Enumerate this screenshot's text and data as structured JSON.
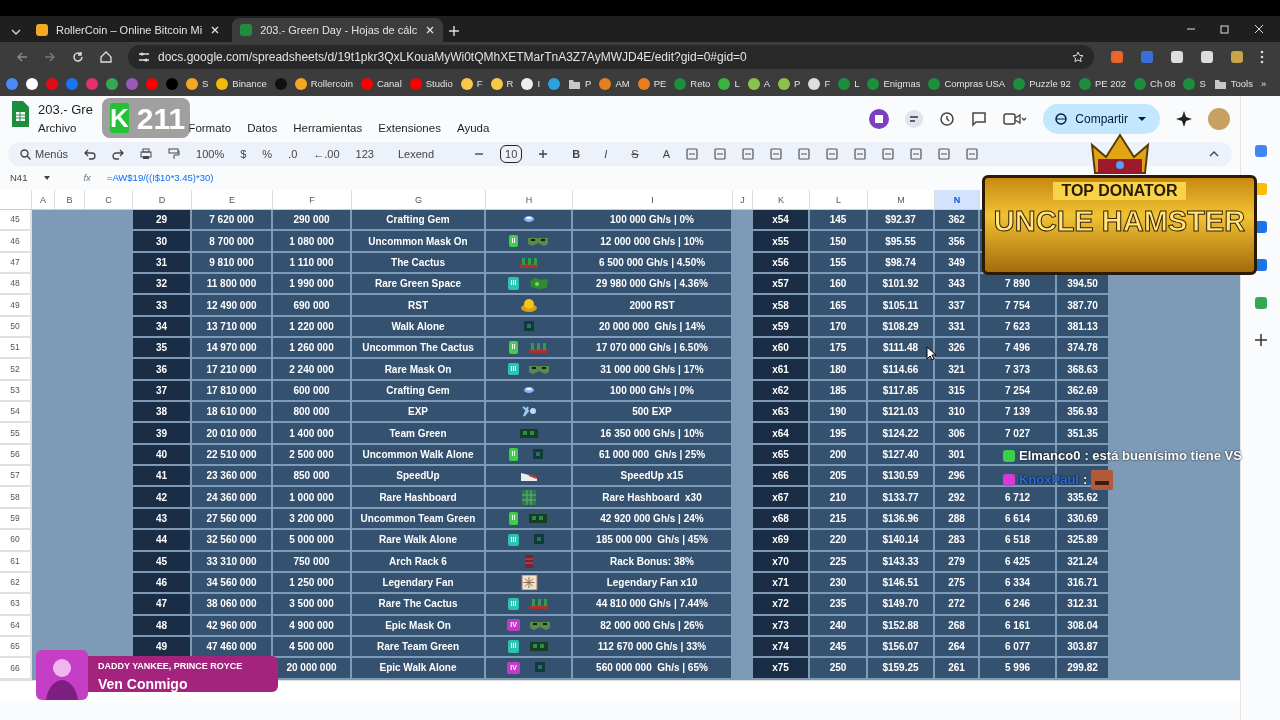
{
  "browser": {
    "tabs": [
      {
        "title": "RollerCoin – Online Bitcoin Mi",
        "color": "#f5a623",
        "selected": false
      },
      {
        "title": "203.- Green Day - Hojas de cálc",
        "color": "#1e8e3e",
        "selected": true
      }
    ],
    "url": "docs.google.com/spreadsheets/d/19t1pkr3QxLKouaMyWi0tQMhXETMarTnA3Z7AyMWJD4E/edit?gid=0#gid=0",
    "bookmarks": [
      {
        "kind": "site",
        "color": "#4a8af4"
      },
      {
        "kind": "site",
        "color": "#ffffff"
      },
      {
        "kind": "site",
        "color": "#e50914"
      },
      {
        "kind": "site",
        "color": "#1877f2"
      },
      {
        "kind": "site",
        "color": "#e1306c"
      },
      {
        "kind": "site",
        "color": "#34a853"
      },
      {
        "kind": "site",
        "color": "#9b59b6"
      },
      {
        "kind": "site",
        "color": "#ff0000"
      },
      {
        "kind": "site",
        "color": "#000000"
      },
      {
        "kind": "site",
        "label": "S",
        "color": "#f5a623"
      },
      {
        "kind": "site",
        "label": "Binance",
        "color": "#f0b90b"
      },
      {
        "kind": "site",
        "color": "#111111"
      },
      {
        "kind": "site",
        "label": "Rollercoin",
        "color": "#f5a623"
      },
      {
        "kind": "site",
        "label": "Canal",
        "color": "#ff0000"
      },
      {
        "kind": "site",
        "label": "Studio",
        "color": "#ff0000"
      },
      {
        "kind": "site",
        "label": "F",
        "color": "#f7c948"
      },
      {
        "kind": "site",
        "label": "R",
        "color": "#f7c948"
      },
      {
        "kind": "site",
        "label": "I",
        "color": "#eeeeee"
      },
      {
        "kind": "site",
        "color": "#2aa3e0"
      },
      {
        "kind": "folder",
        "label": "P",
        "color": "#c4c7c5"
      },
      {
        "kind": "site",
        "label": "AM",
        "color": "#e67e22"
      },
      {
        "kind": "site",
        "label": "PE",
        "color": "#e67e22"
      },
      {
        "kind": "site",
        "label": "Reto",
        "color": "#1e8e3e"
      },
      {
        "kind": "site",
        "label": "L",
        "color": "#3cb043"
      },
      {
        "kind": "site",
        "label": "A",
        "color": "#8bc34a"
      },
      {
        "kind": "site",
        "label": "P",
        "color": "#8bc34a"
      },
      {
        "kind": "site",
        "label": "F",
        "color": "#dddddd"
      },
      {
        "kind": "site",
        "label": "L",
        "color": "#1e8e3e"
      },
      {
        "kind": "site",
        "label": "Enigmas",
        "color": "#1e8e3e"
      },
      {
        "kind": "site",
        "label": "Compras USA",
        "color": "#1e8e3e"
      },
      {
        "kind": "site",
        "label": "Puzzle 92",
        "color": "#1e8e3e"
      },
      {
        "kind": "site",
        "label": "PE 202",
        "color": "#1e8e3e"
      },
      {
        "kind": "site",
        "label": "Ch 08",
        "color": "#1e8e3e"
      },
      {
        "kind": "site",
        "label": "S",
        "color": "#1e8e3e"
      },
      {
        "kind": "folder",
        "label": "Tools",
        "color": "#c4c7c5"
      }
    ],
    "bookmarks_more": "»"
  },
  "sheet": {
    "title": "203.- Gre",
    "menus": [
      "Archivo",
      "Formato",
      "Datos",
      "Herramientas",
      "Extensiones",
      "Ayuda"
    ],
    "share": "Compartir",
    "toolbar": {
      "search": "Menús",
      "zoom": "100%",
      "formats": [
        "$",
        "%",
        ".0",
        "←.00",
        "123"
      ],
      "font": "Lexend",
      "font_size": "10",
      "styles": [
        "B",
        "I",
        "S",
        "A"
      ]
    },
    "formula_bar": {
      "cell": "N41",
      "fx": "fx",
      "formula": "=AW$19/((I$10*3.45)*30)"
    },
    "columns": [
      {
        "label": "A",
        "selected": false
      },
      {
        "label": "B",
        "selected": false
      },
      {
        "label": "C",
        "selected": false
      },
      {
        "label": "D",
        "selected": false
      },
      {
        "label": "E",
        "selected": false
      },
      {
        "label": "F",
        "selected": false
      },
      {
        "label": "G",
        "selected": false
      },
      {
        "label": "H",
        "selected": false
      },
      {
        "label": "I",
        "selected": false
      },
      {
        "label": "J",
        "selected": false
      },
      {
        "label": "K",
        "selected": false
      },
      {
        "label": "L",
        "selected": false
      },
      {
        "label": "M",
        "selected": false
      },
      {
        "label": "N",
        "selected": true
      }
    ],
    "rows": [
      {
        "num": "45",
        "d": "29",
        "e": "7 620 000",
        "f": "290 000",
        "g": "Crafting Gem",
        "h": {
          "kind": "gem"
        },
        "i": "100 000 Gh/s | 0%",
        "k": "x54",
        "l": "145",
        "m": "$92.37",
        "n": "362"
      },
      {
        "num": "46",
        "d": "30",
        "e": "8 700 000",
        "f": "1 080 000",
        "g": "Uncommon Mask On",
        "h": {
          "kind": "mask",
          "tier": "II",
          "color": "#3ccf4a"
        },
        "i": "12 000 000 Gh/s | 10%",
        "k": "x55",
        "l": "150",
        "m": "$95.55",
        "n": "356"
      },
      {
        "num": "47",
        "d": "31",
        "e": "9 810 000",
        "f": "1 110 000",
        "g": "The Cactus",
        "h": {
          "kind": "cactus"
        },
        "i": "6 500 000 Gh/s | 4.50%",
        "k": "x56",
        "l": "155",
        "m": "$98.74",
        "n": "349"
      },
      {
        "num": "48",
        "d": "32",
        "e": "11 800 000",
        "f": "1 990 000",
        "g": "Rare Green Space",
        "h": {
          "kind": "space",
          "tier": "III",
          "color": "#2cc3b0"
        },
        "i": "29 980 000 Gh/s | 4.36%",
        "k": "x57",
        "l": "160",
        "m": "$101.92",
        "n": "343",
        "o": "7 890",
        "p": "394.50"
      },
      {
        "num": "49",
        "d": "33",
        "e": "12 490 000",
        "f": "690 000",
        "g": "RST",
        "h": {
          "kind": "coin"
        },
        "i": "2000 RST",
        "k": "x58",
        "l": "165",
        "m": "$105.11",
        "n": "337",
        "o": "7 754",
        "p": "387.70"
      },
      {
        "num": "50",
        "d": "34",
        "e": "13 710 000",
        "f": "1 220 000",
        "g": "Walk Alone",
        "h": {
          "kind": "walk"
        },
        "i": "20 000 000  Gh/s | 14%",
        "k": "x59",
        "l": "170",
        "m": "$108.29",
        "n": "331",
        "o": "7 623",
        "p": "381.13"
      },
      {
        "num": "51",
        "d": "35",
        "e": "14 970 000",
        "f": "1 260 000",
        "g": "Uncommon The Cactus",
        "h": {
          "kind": "cactus",
          "tier": "II",
          "color": "#3ccf4a"
        },
        "i": "17 070 000 Gh/s | 6.50%",
        "k": "x60",
        "l": "175",
        "m": "$111.48",
        "n": "326",
        "o": "7 496",
        "p": "374.78"
      },
      {
        "num": "52",
        "d": "36",
        "e": "17 210 000",
        "f": "2 240 000",
        "g": "Rare Mask On",
        "h": {
          "kind": "mask",
          "tier": "III",
          "color": "#2cc3b0"
        },
        "i": "31 000 000 Gh/s | 17%",
        "k": "x61",
        "l": "180",
        "m": "$114.66",
        "n": "321",
        "o": "7 373",
        "p": "368.63"
      },
      {
        "num": "53",
        "d": "37",
        "e": "17 810 000",
        "f": "600 000",
        "g": "Crafting Gem",
        "h": {
          "kind": "gem"
        },
        "i": "100 000 Gh/s | 0%",
        "k": "x62",
        "l": "185",
        "m": "$117.85",
        "n": "315",
        "o": "7 254",
        "p": "362.69"
      },
      {
        "num": "54",
        "d": "38",
        "e": "18 610 000",
        "f": "800 000",
        "g": "EXP",
        "h": {
          "kind": "exp"
        },
        "i": "500 EXP",
        "k": "x63",
        "l": "190",
        "m": "$121.03",
        "n": "310",
        "o": "7 139",
        "p": "356.93"
      },
      {
        "num": "55",
        "d": "39",
        "e": "20 010 000",
        "f": "1 400 000",
        "g": "Team Green",
        "h": {
          "kind": "team"
        },
        "i": "16 350 000 Gh/s | 10%",
        "k": "x64",
        "l": "195",
        "m": "$124.22",
        "n": "306",
        "o": "7 027",
        "p": "351.35"
      },
      {
        "num": "56",
        "d": "40",
        "e": "22 510 000",
        "f": "2 500 000",
        "g": "Uncommon Walk Alone",
        "h": {
          "kind": "walk",
          "tier": "II",
          "color": "#3ccf4a"
        },
        "i": "61 000 000  Gh/s | 25%",
        "k": "x65",
        "l": "200",
        "m": "$127.40",
        "n": "301"
      },
      {
        "num": "57",
        "d": "41",
        "e": "23 360 000",
        "f": "850 000",
        "g": "SpeedUp",
        "h": {
          "kind": "shoe"
        },
        "i": "SpeedUp x15",
        "k": "x66",
        "l": "205",
        "m": "$130.59",
        "n": "296"
      },
      {
        "num": "58",
        "d": "42",
        "e": "24 360 000",
        "f": "1 000 000",
        "g": "Rare Hashboard",
        "h": {
          "kind": "board"
        },
        "i": "Rare Hashboard  x30",
        "k": "x67",
        "l": "210",
        "m": "$133.77",
        "n": "292",
        "o": "6 712",
        "p": "335.62"
      },
      {
        "num": "59",
        "d": "43",
        "e": "27 560 000",
        "f": "3 200 000",
        "g": "Uncommon Team Green",
        "h": {
          "kind": "team",
          "tier": "II",
          "color": "#3ccf4a"
        },
        "i": "42 920 000 Gh/s | 24%",
        "k": "x68",
        "l": "215",
        "m": "$136.96",
        "n": "288",
        "o": "6 614",
        "p": "330.69"
      },
      {
        "num": "60",
        "d": "44",
        "e": "32 560 000",
        "f": "5 000 000",
        "g": "Rare Walk Alone",
        "h": {
          "kind": "walk",
          "tier": "III",
          "color": "#2cc3b0"
        },
        "i": "185 000 000  Gh/s | 45%",
        "k": "x69",
        "l": "220",
        "m": "$140.14",
        "n": "283",
        "o": "6 518",
        "p": "325.89"
      },
      {
        "num": "61",
        "d": "45",
        "e": "33 310 000",
        "f": "750 000",
        "g": "Arch Rack 6",
        "h": {
          "kind": "rack"
        },
        "i": "Rack Bonus: 38%",
        "k": "x70",
        "l": "225",
        "m": "$143.33",
        "n": "279",
        "o": "6 425",
        "p": "321.24"
      },
      {
        "num": "62",
        "d": "46",
        "e": "34 560 000",
        "f": "1 250 000",
        "g": "Legendary Fan",
        "h": {
          "kind": "fan"
        },
        "i": "Legendary Fan x10",
        "k": "x71",
        "l": "230",
        "m": "$146.51",
        "n": "275",
        "o": "6 334",
        "p": "316.71"
      },
      {
        "num": "63",
        "d": "47",
        "e": "38 060 000",
        "f": "3 500 000",
        "g": "Rare The Cactus",
        "h": {
          "kind": "cactus",
          "tier": "III",
          "color": "#2cc3b0"
        },
        "i": "44 810 000 Gh/s | 7.44%",
        "k": "x72",
        "l": "235",
        "m": "$149.70",
        "n": "272",
        "o": "6 246",
        "p": "312.31"
      },
      {
        "num": "64",
        "d": "48",
        "e": "42 960 000",
        "f": "4 900 000",
        "g": "Epic Mask On",
        "h": {
          "kind": "mask",
          "tier": "IV",
          "color": "#c23ac8"
        },
        "i": "82 000 000 Gh/s | 26%",
        "k": "x73",
        "l": "240",
        "m": "$152.88",
        "n": "268",
        "o": "6 161",
        "p": "308.04"
      },
      {
        "num": "65",
        "d": "49",
        "e": "47 460 000",
        "f": "4 500 000",
        "g": "Rare Team Green",
        "h": {
          "kind": "team",
          "tier": "III",
          "color": "#2cc3b0"
        },
        "i": "112 670 000 Gh/s | 33%",
        "k": "x74",
        "l": "245",
        "m": "$156.07",
        "n": "264",
        "o": "6 077",
        "p": "303.87"
      },
      {
        "num": "66",
        "f": "20 000 000",
        "g": "Epic Walk Alone",
        "h": {
          "kind": "walk",
          "tier": "IV",
          "color": "#c23ac8"
        },
        "i": "560 000 000  Gh/s | 65%",
        "k": "x75",
        "l": "250",
        "m": "$159.25",
        "n": "261",
        "o": "5 996",
        "p": "299.82"
      }
    ]
  },
  "overlays": {
    "channel_badge": {
      "letter": "K",
      "number": "211"
    },
    "donator": {
      "heading": "TOP DONATOR",
      "name": "UNCLE HAMSTER"
    },
    "chat": [
      {
        "user": "Elmanco0",
        "message": ": está buenísimo tiene VS",
        "color": "#3ccf4a"
      },
      {
        "user": "KnoxPaul",
        "message": ":",
        "color": "#d53ad8"
      }
    ],
    "now_playing": {
      "artist": "DADDY YANKEE, PRINCE ROYCE",
      "song": "Ven Conmigo"
    }
  }
}
